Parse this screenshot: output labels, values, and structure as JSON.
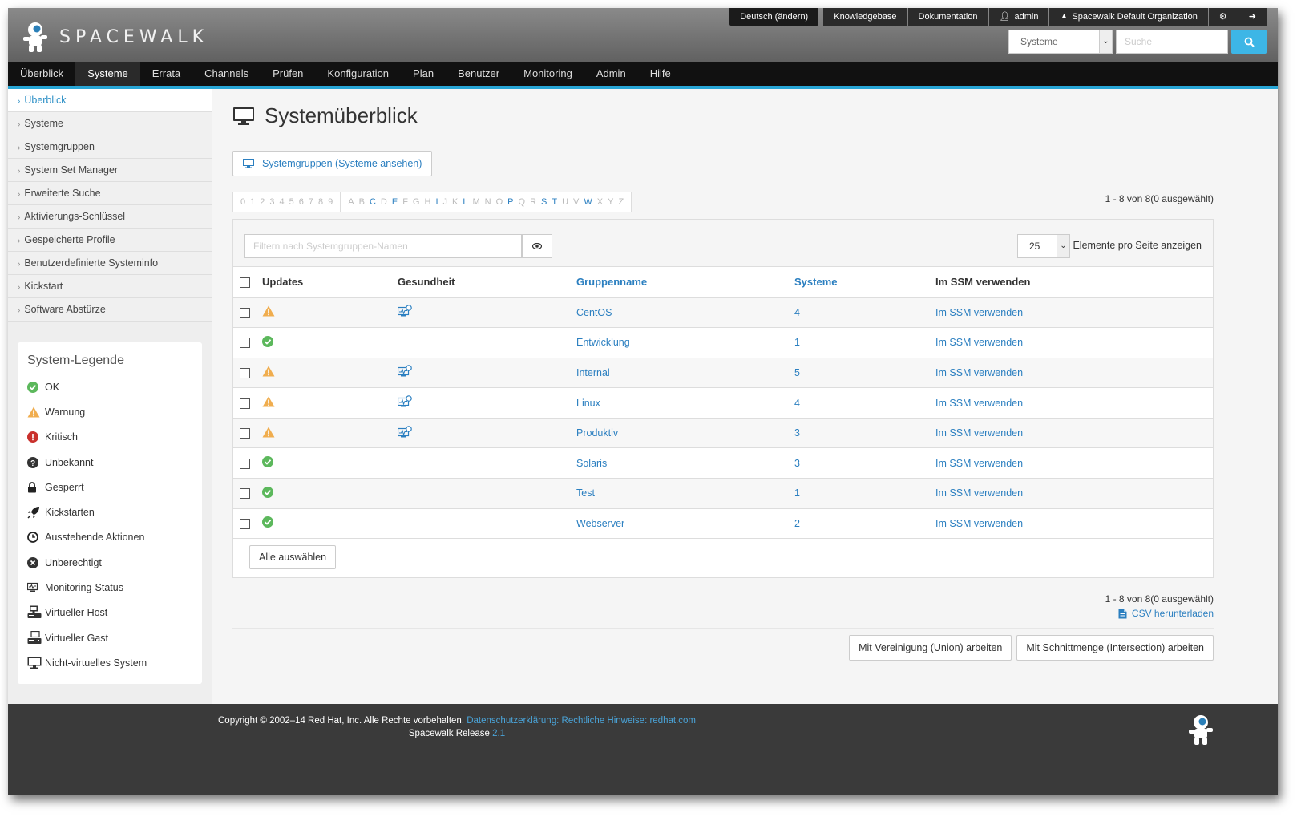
{
  "header": {
    "logo_text": "SPACEWALK",
    "language": "Deutsch (ändern)",
    "knowledgebase": "Knowledgebase",
    "documentation": "Dokumentation",
    "user": "admin",
    "organization": "Spacewalk Default Organization",
    "search_scope": "Systeme",
    "search_placeholder": "Suche"
  },
  "nav": [
    "Überblick",
    "Systeme",
    "Errata",
    "Channels",
    "Prüfen",
    "Konfiguration",
    "Plan",
    "Benutzer",
    "Monitoring",
    "Admin",
    "Hilfe"
  ],
  "nav_active": "Systeme",
  "sidebar": {
    "items": [
      "Überblick",
      "Systeme",
      "Systemgruppen",
      "System Set Manager",
      "Erweiterte Suche",
      "Aktivierungs-Schlüssel",
      "Gespeicherte Profile",
      "Benutzerdefinierte Systeminfo",
      "Kickstart",
      "Software Abstürze"
    ],
    "active": "Überblick"
  },
  "legend": {
    "title": "System-Legende",
    "items": [
      {
        "label": "OK",
        "icon": "ok-icon"
      },
      {
        "label": "Warnung",
        "icon": "warning-icon"
      },
      {
        "label": "Kritisch",
        "icon": "critical-icon"
      },
      {
        "label": "Unbekannt",
        "icon": "unknown-icon"
      },
      {
        "label": "Gesperrt",
        "icon": "lock-icon"
      },
      {
        "label": "Kickstarten",
        "icon": "rocket-icon"
      },
      {
        "label": "Ausstehende Aktionen",
        "icon": "clock-icon"
      },
      {
        "label": "Unberechtigt",
        "icon": "unentitled-icon"
      },
      {
        "label": "Monitoring-Status",
        "icon": "monitoring-icon"
      },
      {
        "label": "Virtueller Host",
        "icon": "virtual-host-icon"
      },
      {
        "label": "Virtueller Gast",
        "icon": "virtual-guest-icon"
      },
      {
        "label": "Nicht-virtuelles System",
        "icon": "monitor-icon"
      }
    ]
  },
  "page": {
    "title": "Systemüberblick",
    "group_button": "Systemgruppen (Systeme ansehen)",
    "count_text": "1 - 8 von 8(0 ausgewählt)",
    "filter_placeholder": "Filtern nach Systemgruppen-Namen",
    "per_page": "25",
    "per_page_label": "Elemente pro Seite anzeigen",
    "select_all": "Alle auswählen",
    "csv": "CSV herunterladen",
    "union_button": "Mit Vereinigung (Union) arbeiten",
    "intersection_button": "Mit Schnittmenge (Intersection) arbeiten"
  },
  "alphabet": {
    "digits": [
      "0",
      "1",
      "2",
      "3",
      "4",
      "5",
      "6",
      "7",
      "8",
      "9"
    ],
    "letters": [
      "A",
      "B",
      "C",
      "D",
      "E",
      "F",
      "G",
      "H",
      "I",
      "J",
      "K",
      "L",
      "M",
      "N",
      "O",
      "P",
      "Q",
      "R",
      "S",
      "T",
      "U",
      "V",
      "W",
      "X",
      "Y",
      "Z"
    ],
    "enabled": [
      "C",
      "E",
      "I",
      "L",
      "P",
      "S",
      "T",
      "W"
    ]
  },
  "table": {
    "columns": [
      "Updates",
      "Gesundheit",
      "Gruppenname",
      "Systeme",
      "Im SSM verwenden"
    ],
    "rows": [
      {
        "updates": "warning",
        "health": true,
        "name": "CentOS",
        "systems": "4",
        "ssm": "Im SSM verwenden"
      },
      {
        "updates": "ok",
        "health": false,
        "name": "Entwicklung",
        "systems": "1",
        "ssm": "Im SSM verwenden"
      },
      {
        "updates": "warning",
        "health": true,
        "name": "Internal",
        "systems": "5",
        "ssm": "Im SSM verwenden"
      },
      {
        "updates": "warning",
        "health": true,
        "name": "Linux",
        "systems": "4",
        "ssm": "Im SSM verwenden"
      },
      {
        "updates": "warning",
        "health": true,
        "name": "Produktiv",
        "systems": "3",
        "ssm": "Im SSM verwenden"
      },
      {
        "updates": "ok",
        "health": false,
        "name": "Solaris",
        "systems": "3",
        "ssm": "Im SSM verwenden"
      },
      {
        "updates": "ok",
        "health": false,
        "name": "Test",
        "systems": "1",
        "ssm": "Im SSM verwenden"
      },
      {
        "updates": "ok",
        "health": false,
        "name": "Webserver",
        "systems": "2",
        "ssm": "Im SSM verwenden"
      }
    ]
  },
  "footer": {
    "copyright": "Copyright © 2002–14 Red Hat, Inc. Alle Rechte vorbehalten.",
    "privacy": "Datenschutzerklärung",
    "legal": "Rechtliche Hinweise",
    "redhat": "redhat.com",
    "release_label": "Spacewalk Release",
    "release_version": "2.1"
  },
  "colors": {
    "accent": "#28a6d6",
    "link": "#2b7fc0",
    "ok": "#5cb85c",
    "warning": "#f0ad4e",
    "critical": "#d9534f"
  }
}
